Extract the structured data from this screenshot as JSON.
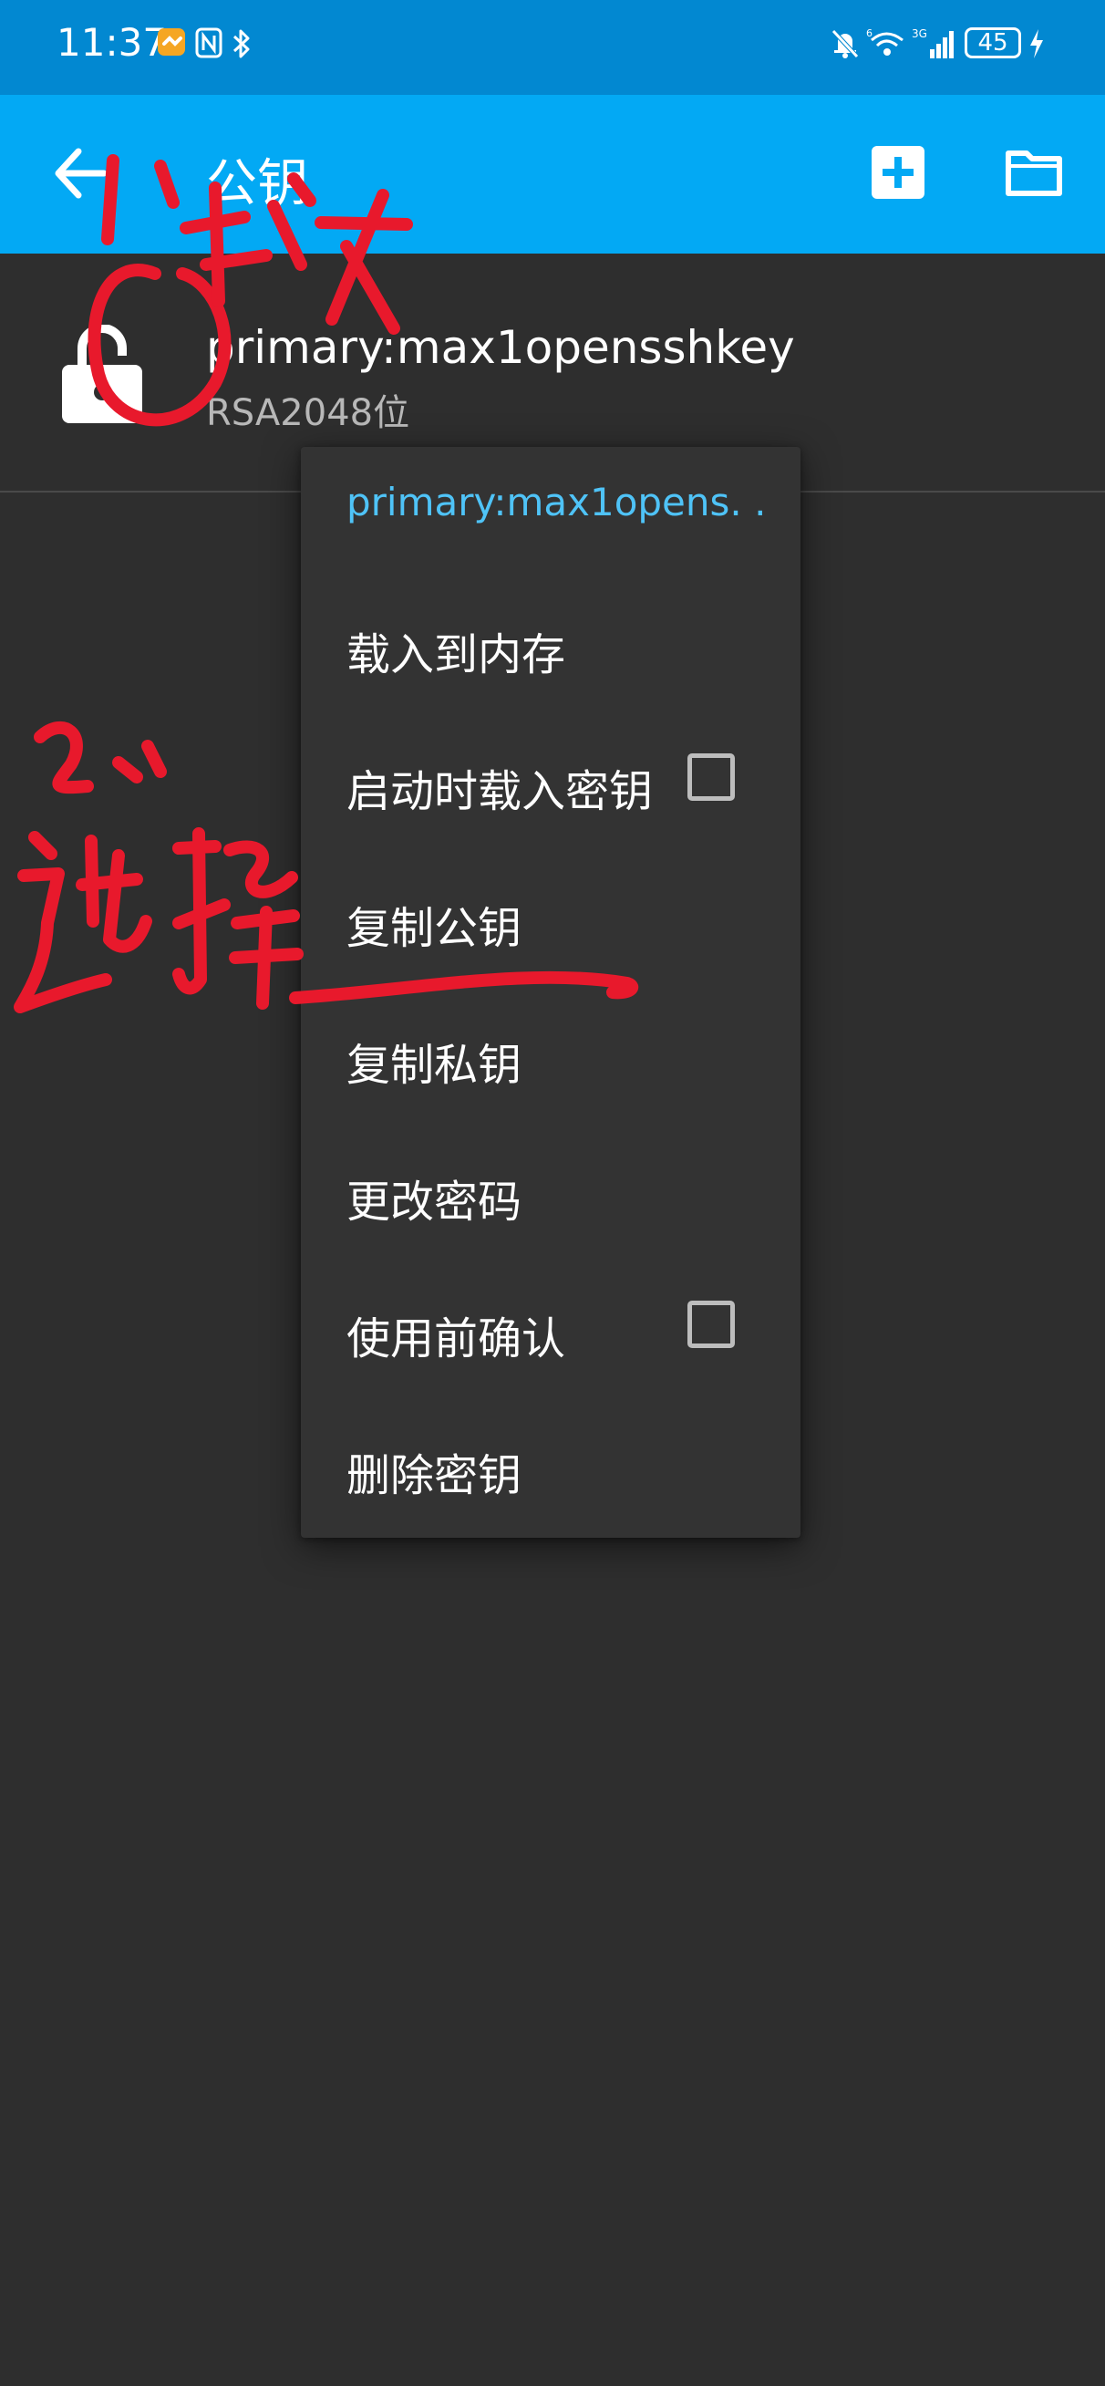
{
  "status_bar": {
    "time": "11:37",
    "battery": "45",
    "icons": [
      "app-notification-icon",
      "nfc-icon",
      "bluetooth-icon",
      "mute-icon",
      "wifi-icon",
      "signal-icon",
      "charging-icon"
    ]
  },
  "app_bar": {
    "title": "公钥",
    "icons": [
      "back-arrow-icon",
      "add-icon",
      "folder-icon"
    ]
  },
  "key_list": [
    {
      "name": "primary:max1opensshkey",
      "description": "RSA2048位",
      "icon": "lock-open-icon"
    }
  ],
  "popup_menu": {
    "header": "primary:max1opens. .",
    "items": [
      {
        "label": "载入到内存"
      },
      {
        "label": "启动时载入密钥",
        "checkbox": false
      },
      {
        "label": "复制公钥"
      },
      {
        "label": "复制私钥"
      },
      {
        "label": "更改密码"
      },
      {
        "label": "使用前确认",
        "checkbox": false
      },
      {
        "label": "删除密钥"
      }
    ]
  },
  "colors": {
    "status_bar": "#0288d1",
    "app_bar": "#03a9f4",
    "background": "#2e2e2e",
    "menu_background": "#333333",
    "menu_header": "#4fc3f7",
    "annotation": "#e8192c"
  }
}
